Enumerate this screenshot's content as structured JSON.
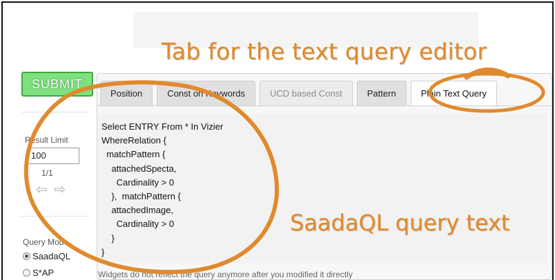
{
  "annotations": {
    "tab_caption": "Tab for the text query editor",
    "query_caption": "SaadaQL query text"
  },
  "toolbar": {
    "submit_label": "SUBMIT"
  },
  "left_panel": {
    "result_limit_label": "Result Limit",
    "result_limit_value": "100",
    "pager_text": "1/1",
    "arrows_glyph": "⇦ ⇨",
    "query_mode_label": "Query Mode",
    "query_modes": [
      {
        "label": "SaadaQL",
        "checked": true
      },
      {
        "label": "S*AP",
        "checked": false
      }
    ]
  },
  "tabs": [
    {
      "label": "Position",
      "state": "normal"
    },
    {
      "label": "Const on Keywords",
      "state": "normal"
    },
    {
      "label": "UCD based Const",
      "state": "disabled"
    },
    {
      "label": "Pattern",
      "state": "normal"
    },
    {
      "label": "Plain Text Query",
      "state": "active"
    }
  ],
  "editor": {
    "query_text": "Select ENTRY From * In Vizier\nWhereRelation {\n  matchPattern {\n    attachedSpecta,\n      Cardinality > 0\n    },  matchPattern {\n    attachedImage,\n      Cardinality > 0\n    }\n}",
    "footer_note": "Widgets do not reflect the query anymore after you modified it directly"
  },
  "colors": {
    "annotation_orange": "#e08a2e",
    "submit_green": "#7fe07f",
    "panel_bg": "#f7f7f7"
  }
}
